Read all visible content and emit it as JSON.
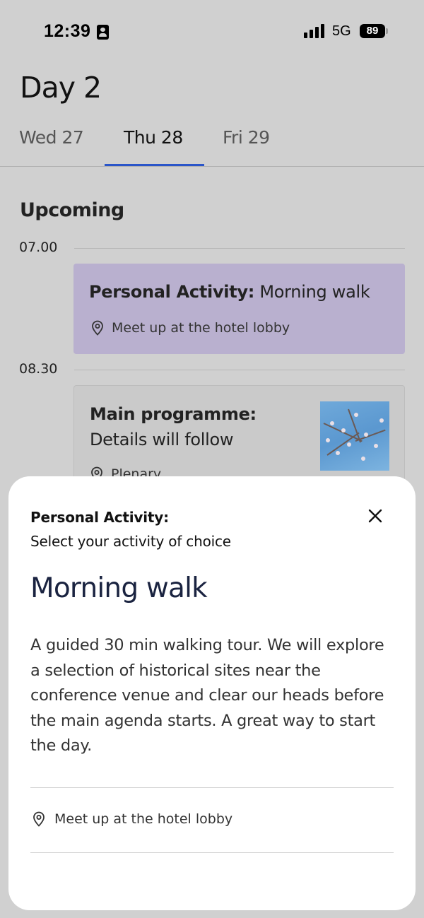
{
  "status_bar": {
    "time": "12:39",
    "network": "5G",
    "battery": "89"
  },
  "header": {
    "title": "Day 2",
    "tabs": [
      {
        "label": "Wed 27",
        "active": false
      },
      {
        "label": "Thu 28",
        "active": true
      },
      {
        "label": "Fri 29",
        "active": false
      }
    ]
  },
  "schedule": {
    "section_title": "Upcoming",
    "slots": [
      {
        "time": "07.00",
        "event": {
          "category": "Personal Activity:",
          "title": "Morning walk",
          "location": "Meet up at the hotel lobby",
          "color": "#b9b0cf"
        }
      },
      {
        "time": "08.30",
        "event": {
          "category": "Main programme:",
          "title": "Details will follow",
          "location": "Plenary"
        }
      }
    ]
  },
  "sheet": {
    "kicker": "Personal Activity:",
    "subtitle": "Select your activity of choice",
    "title": "Morning walk",
    "description": "A guided 30 min walking tour. We will explore a selection of historical sites near the conference venue and clear our heads before the main agenda starts. A great way to start the day.",
    "location": "Meet up at the hotel lobby",
    "close_icon": "close-icon"
  },
  "colors": {
    "accent": "#2a55c9",
    "sheet_title": "#1a2340",
    "personal_activity": "#b9b0cf"
  }
}
